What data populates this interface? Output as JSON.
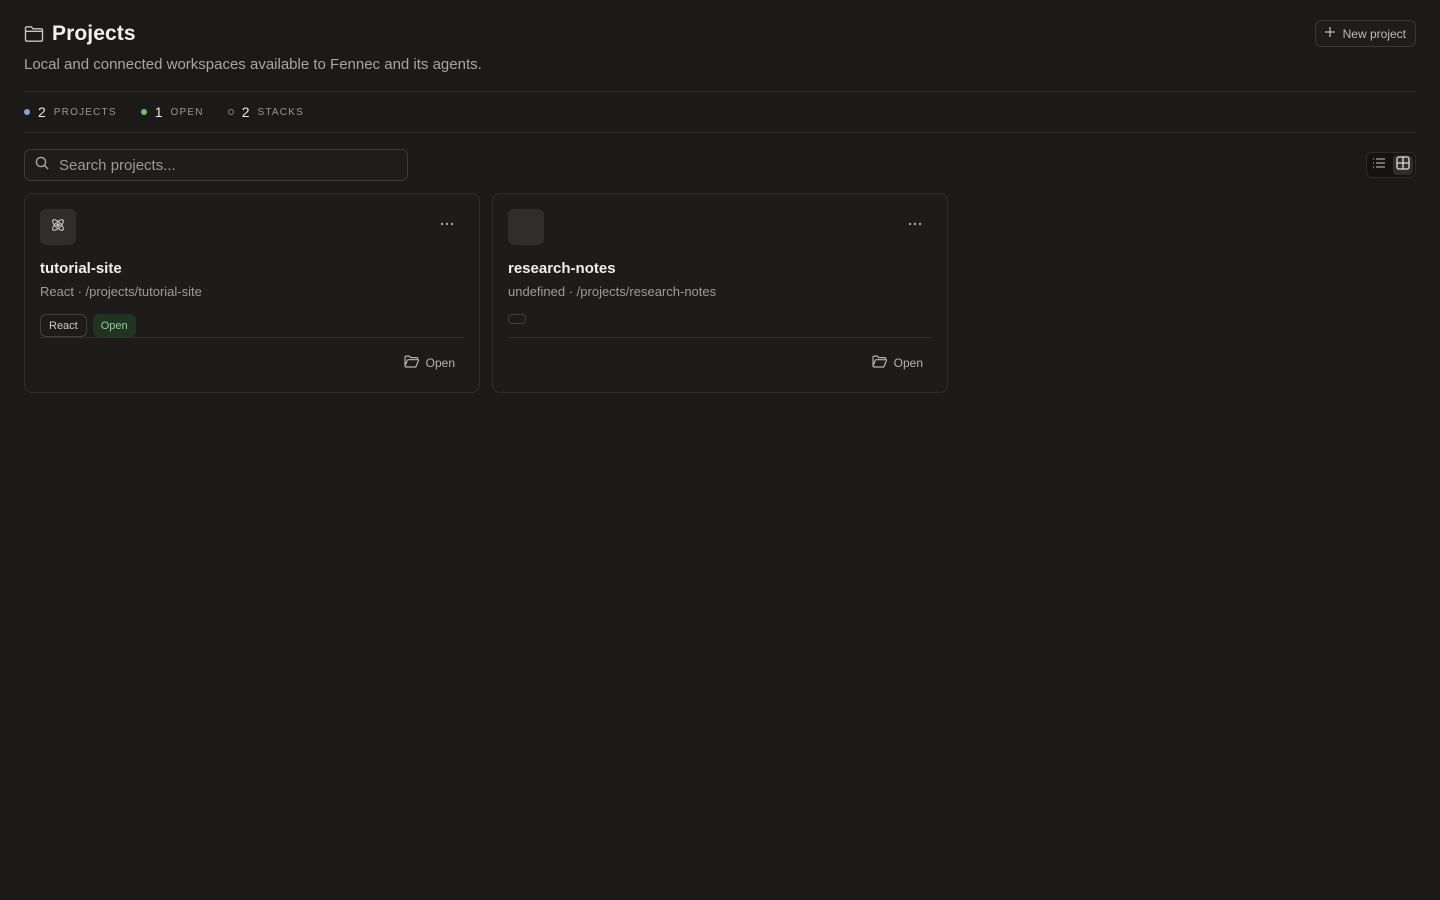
{
  "header": {
    "title": "Projects",
    "subtitle": "Local and connected workspaces available to Fennec and its agents.",
    "new_project_label": "New project",
    "folder_icon": "folder-icon",
    "plus_icon": "plus-icon"
  },
  "stats": [
    {
      "count": "2",
      "label": "PROJECTS",
      "dot_color": "#8aa4d6"
    },
    {
      "count": "1",
      "label": "OPEN",
      "dot_color": "#6cc06c"
    },
    {
      "count": "2",
      "label": "STACKS",
      "dot_color": "hollow"
    }
  ],
  "search": {
    "placeholder": "Search projects...",
    "value": ""
  },
  "view_toggle": {
    "options": [
      "list-view-icon",
      "grid-view-icon"
    ],
    "active": "grid-view-icon"
  },
  "projects": [
    {
      "name": "tutorial-site",
      "meta": "React · /projects/tutorial-site",
      "icon": "react-icon",
      "tags": [
        "React"
      ],
      "status": "Open",
      "open_label": "Open"
    },
    {
      "name": "research-notes",
      "meta": "undefined · /projects/research-notes",
      "icon": "",
      "tags": [
        ""
      ],
      "status": "",
      "open_label": "Open"
    }
  ],
  "colors": {
    "background": "#1b1a19",
    "card": "#1d1c1a",
    "status_green": "#8fcf8f"
  }
}
